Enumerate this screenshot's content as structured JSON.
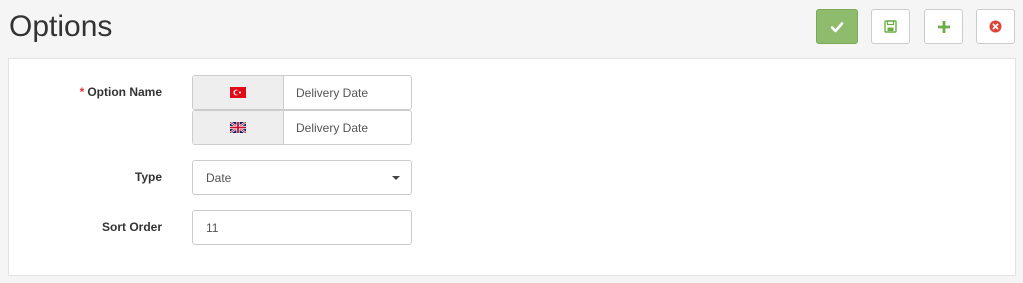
{
  "header": {
    "title": "Options"
  },
  "toolbar": {
    "save_icon": "check-icon",
    "save_stay_icon": "floppy-disk-icon",
    "add_icon": "plus-icon",
    "cancel_icon": "close-circle-icon",
    "colors": {
      "save_bg": "#8fbb6c",
      "add": "#6cae45",
      "cancel": "#e0433a"
    }
  },
  "form": {
    "option_name": {
      "required_marker": "*",
      "label": "Option Name",
      "languages": [
        {
          "flag": "turkey-flag-icon",
          "value": "Delivery Date"
        },
        {
          "flag": "uk-flag-icon",
          "value": "Delivery Date"
        }
      ]
    },
    "type": {
      "label": "Type",
      "value": "Date"
    },
    "sort_order": {
      "label": "Sort Order",
      "value": "11"
    }
  }
}
